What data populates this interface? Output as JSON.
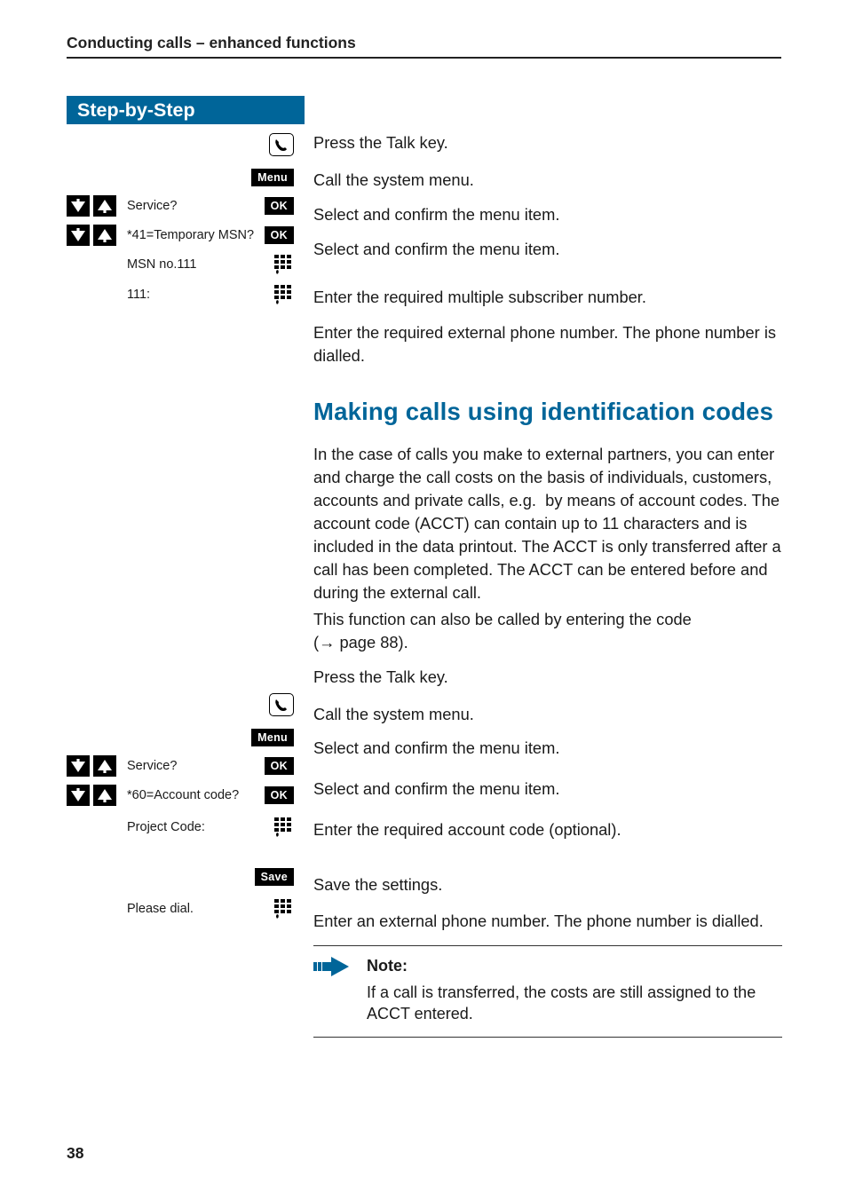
{
  "header": "Conducting calls – enhanced functions",
  "page_number": "38",
  "step_banner": "Step-by-Step",
  "buttons": {
    "menu": "Menu",
    "ok": "OK",
    "save": "Save"
  },
  "section1": {
    "steps": {
      "talk": "Press the Talk key.",
      "menu": "Call the system menu.",
      "service_label": "Service?",
      "service_desc": "Select and confirm the menu item.",
      "temp_msn_label": "*41=Temporary MSN?",
      "temp_msn_desc": "Select and confirm the menu item.",
      "msn_no_label": "MSN no.111",
      "msn_no_desc": "Enter the required multiple subscriber number.",
      "dial_label": "111:",
      "dial_desc": "Enter the required external phone number. The phone number is dialled."
    }
  },
  "section2": {
    "heading": "Making calls using identification codes",
    "intro1": "In the case of calls you make to external partners, you can enter and charge the call costs on the basis of individuals, customers, accounts and private calls, e.g.  by means of account codes. The account code (ACCT) can contain up to 11 characters and is included in the data printout. The ACCT is only transferred after a call has been completed. The ACCT can be entered before and during the external call.",
    "intro2_a": "This function can also be called by entering the code (",
    "intro2_b": "→ page 88).",
    "steps": {
      "talk": "Press the Talk key.",
      "menu": "Call the system menu.",
      "service_label": "Service?",
      "service_desc": "Select and confirm the menu item.",
      "acct_label": "*60=Account code?",
      "acct_desc": "Select and confirm the menu item.",
      "proj_label": "Project Code:",
      "proj_desc": "Enter the required account code (optional).",
      "save_desc": "Save the settings.",
      "please_dial_label": "Please dial.",
      "please_dial_desc": "Enter an external phone number. The phone number is dialled."
    },
    "note_title": "Note:",
    "note_body": "If a call is transferred, the costs are still assigned to the ACCT entered."
  }
}
